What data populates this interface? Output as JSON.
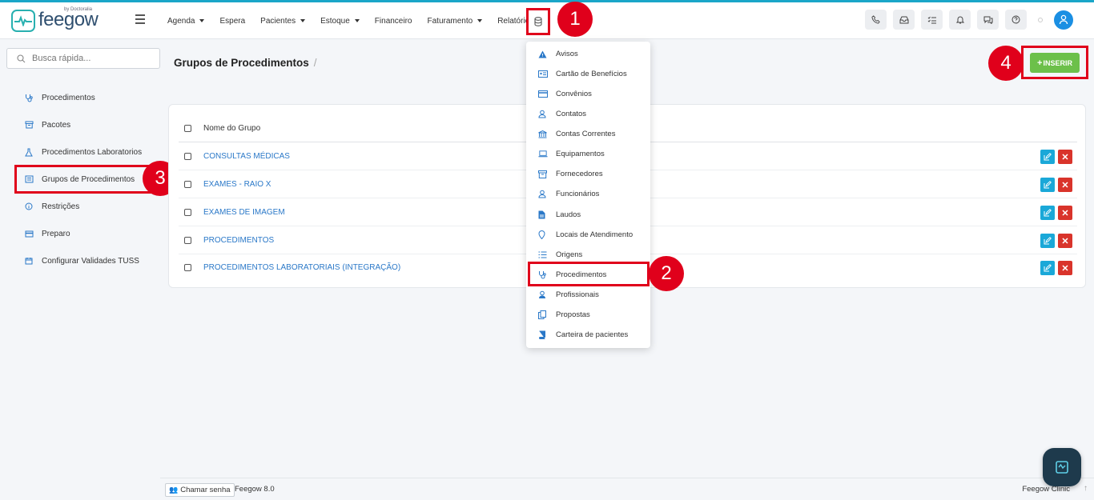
{
  "header": {
    "logo_text": "feegow",
    "logo_by": "by Doctoralia",
    "nav": [
      {
        "label": "Agenda",
        "caret": true
      },
      {
        "label": "Espera",
        "caret": false
      },
      {
        "label": "Pacientes",
        "caret": true
      },
      {
        "label": "Estoque",
        "caret": true
      },
      {
        "label": "Financeiro",
        "caret": false
      },
      {
        "label": "Faturamento",
        "caret": true
      },
      {
        "label": "Relatórios",
        "caret": false
      }
    ],
    "right_icons": [
      "phone-icon",
      "inbox-icon",
      "checklist-icon",
      "bell-icon",
      "chat-icon",
      "help-icon"
    ]
  },
  "search": {
    "placeholder": "Busca rápida..."
  },
  "sidebar": {
    "items": [
      {
        "label": "Procedimentos",
        "icon": "stethoscope-icon"
      },
      {
        "label": "Pacotes",
        "icon": "box-icon"
      },
      {
        "label": "Procedimentos Laboratorios",
        "icon": "flask-icon"
      },
      {
        "label": "Grupos de Procedimentos",
        "icon": "group-icon"
      },
      {
        "label": "Restrições",
        "icon": "info-icon"
      },
      {
        "label": "Preparo",
        "icon": "card-icon"
      },
      {
        "label": "Configurar Validades TUSS",
        "icon": "calendar-icon"
      }
    ]
  },
  "page": {
    "title": "Grupos de Procedimentos",
    "separator": "/"
  },
  "insert_button": {
    "label": "INSERIR",
    "icon": "plus-icon"
  },
  "table": {
    "header": "Nome do Grupo",
    "rows": [
      "CONSULTAS MÉDICAS",
      "EXAMES - RAIO X",
      "EXAMES DE IMAGEM",
      "PROCEDIMENTOS",
      "PROCEDIMENTOS LABORATORIAIS (INTEGRAÇÃO)"
    ]
  },
  "dropdown": {
    "items": [
      {
        "label": "Avisos",
        "icon": "warning-icon"
      },
      {
        "label": "Cartão de Benefícios",
        "icon": "id-card-icon"
      },
      {
        "label": "Convênios",
        "icon": "credit-card-icon"
      },
      {
        "label": "Contatos",
        "icon": "user-icon"
      },
      {
        "label": "Contas Correntes",
        "icon": "bank-icon"
      },
      {
        "label": "Equipamentos",
        "icon": "laptop-icon"
      },
      {
        "label": "Fornecedores",
        "icon": "archive-icon"
      },
      {
        "label": "Funcionários",
        "icon": "user-icon"
      },
      {
        "label": "Laudos",
        "icon": "document-icon"
      },
      {
        "label": "Locais de Atendimento",
        "icon": "map-pin-icon"
      },
      {
        "label": "Origens",
        "icon": "list-icon"
      },
      {
        "label": "Procedimentos",
        "icon": "stethoscope-icon"
      },
      {
        "label": "Profissionais",
        "icon": "user-tie-icon"
      },
      {
        "label": "Propostas",
        "icon": "copy-icon"
      },
      {
        "label": "Carteira de pacientes",
        "icon": "book-icon"
      }
    ]
  },
  "annotations": {
    "step1": "1",
    "step2": "2",
    "step3": "3",
    "step4": "4"
  },
  "footer": {
    "call_label": "Chamar senha",
    "version": "Feegow 8.0",
    "clinic": "Feegow Clinic"
  },
  "colors": {
    "accent": "#1aa6c8",
    "link": "#2a78c8",
    "insert": "#6cc04a",
    "highlight": "#e0001b",
    "edit": "#1aa8d8",
    "delete": "#d9342b"
  }
}
